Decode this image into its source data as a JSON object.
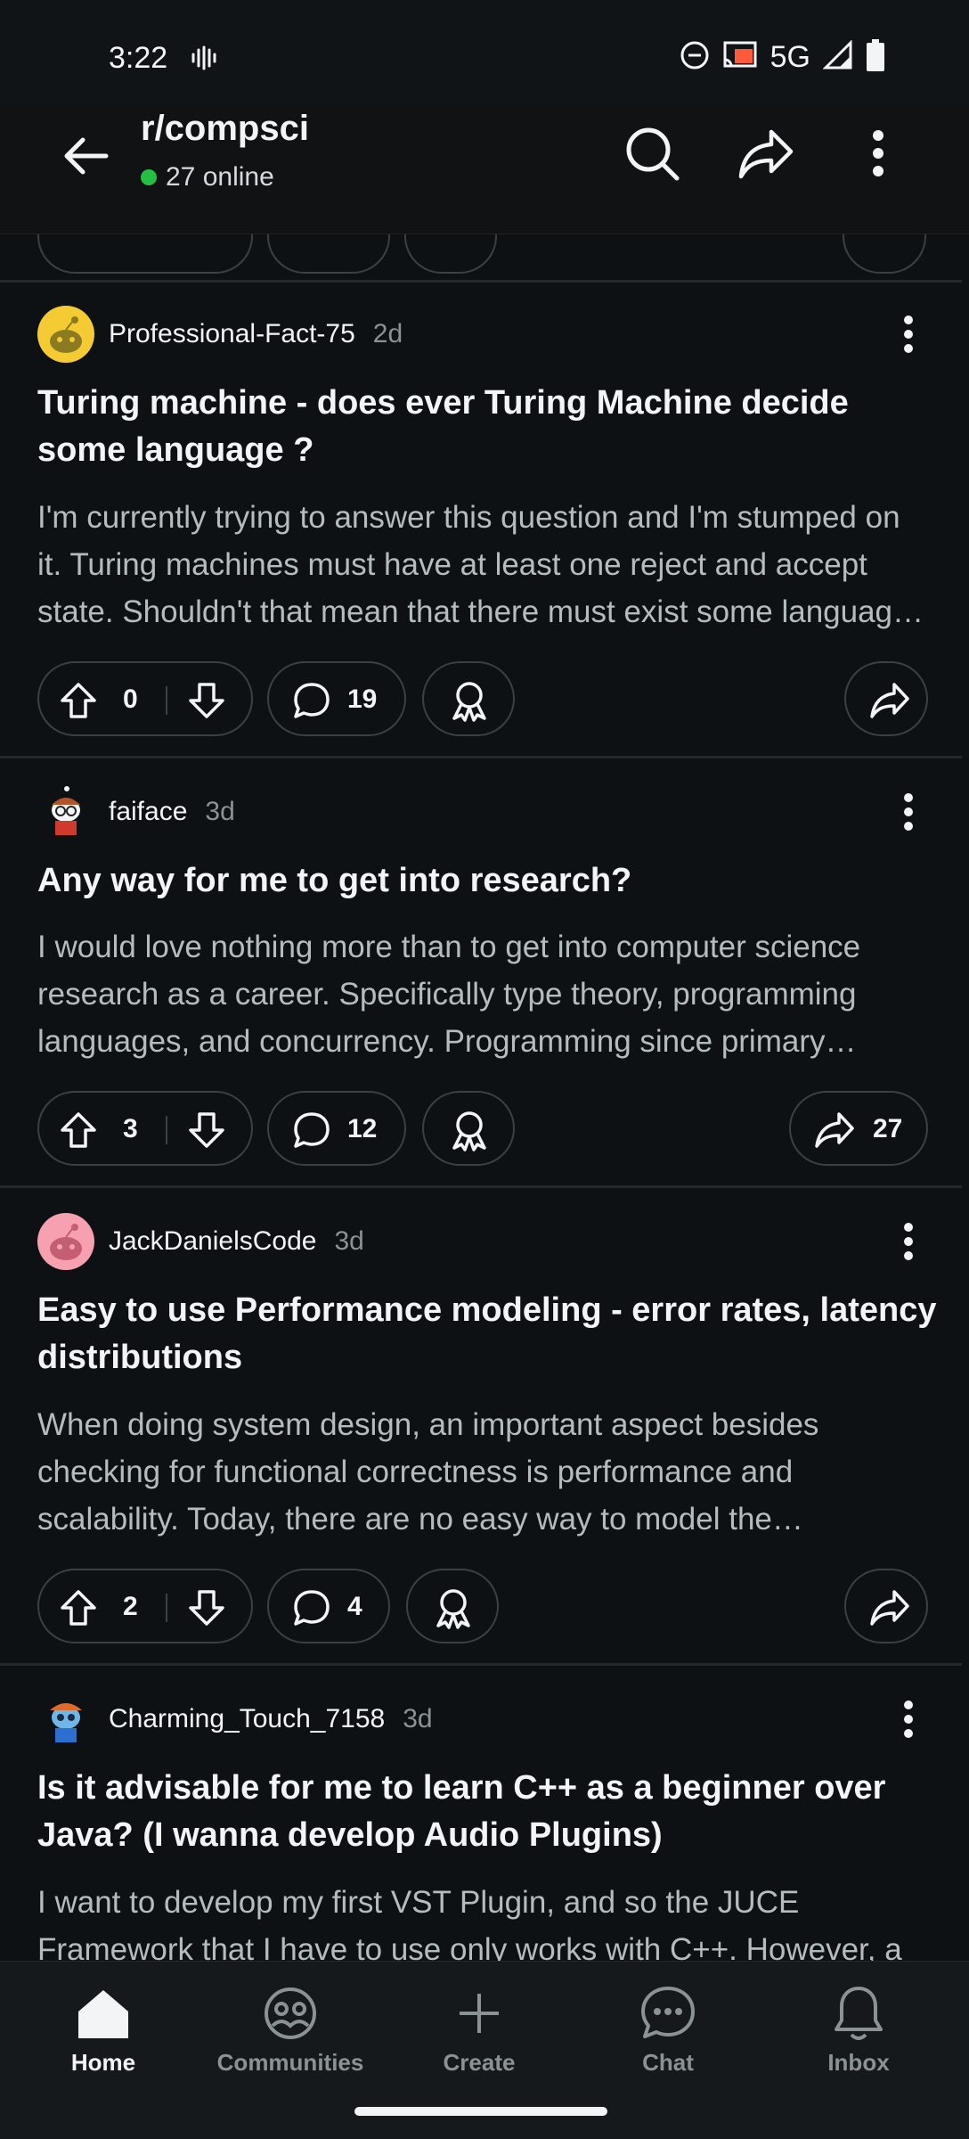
{
  "status_bar": {
    "time": "3:22",
    "network": "5G"
  },
  "header": {
    "subreddit": "r/compsci",
    "online": "27 online"
  },
  "posts": [
    {
      "username": "Professional-Fact-75",
      "age": "2d",
      "title": "Turing machine - does ever Turing Machine decide some language ?",
      "body": "I'm currently trying to answer this question and I'm stumped on it. Turing machines must have at least one reject and accept state. Shouldn't that mean that there must exist some language that the machine decides?",
      "votes": "0",
      "comments": "19",
      "shares": ""
    },
    {
      "username": "faiface",
      "age": "3d",
      "title": "Any way for me to get into research?",
      "body": "I would love nothing more than to get into computer science research as a career. Specifically type theory, programming languages, and concurrency. Programming since primary school.",
      "votes": "3",
      "comments": "12",
      "shares": "27"
    },
    {
      "username": "JackDanielsCode",
      "age": "3d",
      "title": "Easy to use Performance modeling - error rates, latency distributions",
      "body": "When doing system design, an important aspect besides checking for functional correctness is performance and scalability. Today, there are no easy way to model the performance of a system.",
      "votes": "2",
      "comments": "4",
      "shares": ""
    },
    {
      "username": "Charming_Touch_7158",
      "age": "3d",
      "title": "Is it advisable for me to learn C++ as a beginner over Java? (I wanna develop Audio Plugins)",
      "body": "I want to develop my first VST Plugin, and so the JUCE Framework that I have to use only works with C++. However, a"
    }
  ],
  "nav": {
    "home": "Home",
    "communities": "Communities",
    "create": "Create",
    "chat": "Chat",
    "inbox": "Inbox"
  },
  "colors": {
    "background": "#0e1113",
    "online_dot": "#23c044",
    "text_primary": "#f2f4f5",
    "text_secondary": "#b4bcc0"
  }
}
